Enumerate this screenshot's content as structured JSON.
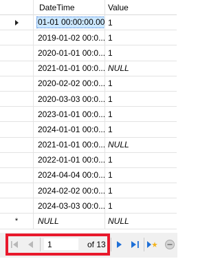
{
  "grid": {
    "columns": [
      "DateTime",
      "Value"
    ],
    "rows": [
      {
        "datetime": "01-01 00:00:00.000",
        "value": "1",
        "null": false,
        "current": true
      },
      {
        "datetime": "2019-01-02 00:0...",
        "value": "1",
        "null": false
      },
      {
        "datetime": "2020-01-01 00:0...",
        "value": "1",
        "null": false
      },
      {
        "datetime": "2021-01-01 00:0...",
        "value": "NULL",
        "null": true
      },
      {
        "datetime": "2020-02-02 00:0...",
        "value": "1",
        "null": false
      },
      {
        "datetime": "2020-03-03 00:0...",
        "value": "1",
        "null": false
      },
      {
        "datetime": "2023-01-01 00:0...",
        "value": "1",
        "null": false
      },
      {
        "datetime": "2024-01-01 00:0...",
        "value": "1",
        "null": false
      },
      {
        "datetime": "2021-01-01 00:0...",
        "value": "NULL",
        "null": true
      },
      {
        "datetime": "2022-01-01 00:0...",
        "value": "1",
        "null": false
      },
      {
        "datetime": "2024-04-04 00:0...",
        "value": "1",
        "null": false
      },
      {
        "datetime": "2024-02-02 00:0...",
        "value": "1",
        "null": false
      },
      {
        "datetime": "2024-03-03 00:0...",
        "value": "1",
        "null": false
      }
    ],
    "new_row": {
      "datetime": "NULL",
      "value": "NULL",
      "marker": "*"
    }
  },
  "navigator": {
    "position": "1",
    "of_label": "of 13",
    "icons": [
      "move-first-icon",
      "move-previous-icon",
      "move-next-icon",
      "move-last-icon",
      "add-new-icon",
      "delete-icon"
    ]
  },
  "colors": {
    "highlight": "#e8192c",
    "nav_blue": "#1e6fd6",
    "selection": "#cce8ff"
  }
}
